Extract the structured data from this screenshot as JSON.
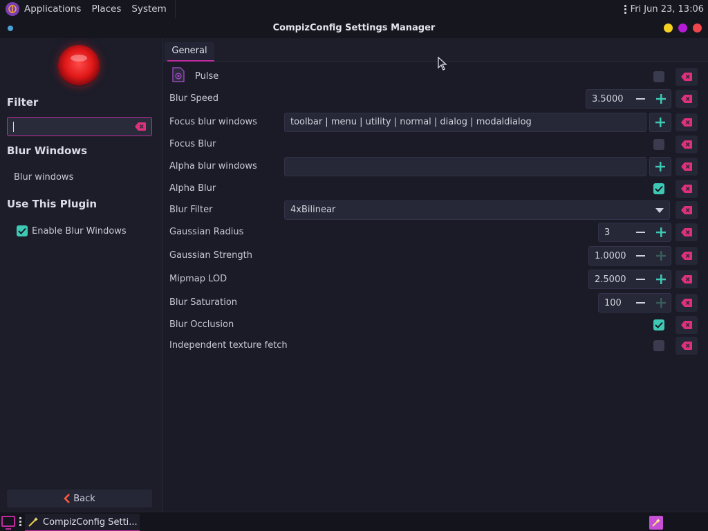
{
  "top_panel": {
    "menu": [
      "Applications",
      "Places",
      "System"
    ],
    "clock": "Fri Jun 23, 13:06"
  },
  "window": {
    "title": "CompizConfig Settings Manager",
    "controls": [
      "minimize",
      "maximize",
      "close"
    ],
    "control_colors": [
      "#f4d21f",
      "#b61bd8",
      "#f0464b"
    ]
  },
  "sidebar": {
    "filter_heading": "Filter",
    "filter_value": "",
    "plugin_heading": "Blur Windows",
    "plugin_description": "Blur windows",
    "use_heading": "Use This Plugin",
    "enable_label": "Enable Blur Windows",
    "enable_checked": true,
    "back_label": "Back"
  },
  "tabs": [
    {
      "label": "General",
      "active": true
    }
  ],
  "settings": [
    {
      "label": "Pulse",
      "type": "checkbox",
      "checked": false
    },
    {
      "label": "Blur Speed",
      "type": "spin",
      "value": "3.5000",
      "plus_enabled": true
    },
    {
      "label": "Focus blur windows",
      "type": "match",
      "value": "toolbar | menu | utility | normal | dialog | modaldialog"
    },
    {
      "label": "Focus Blur",
      "type": "checkbox",
      "checked": false
    },
    {
      "label": "Alpha blur windows",
      "type": "match",
      "value": ""
    },
    {
      "label": "Alpha Blur",
      "type": "checkbox",
      "checked": true
    },
    {
      "label": "Blur Filter",
      "type": "combo",
      "value": "4xBilinear"
    },
    {
      "label": "Gaussian Radius",
      "type": "spin",
      "value": "3",
      "plus_enabled": true
    },
    {
      "label": "Gaussian Strength",
      "type": "spin",
      "value": "1.0000",
      "plus_enabled": false
    },
    {
      "label": "Mipmap LOD",
      "type": "spin",
      "value": "2.5000",
      "plus_enabled": true
    },
    {
      "label": "Blur Saturation",
      "type": "spin",
      "value": "100",
      "plus_enabled": false
    },
    {
      "label": "Blur Occlusion",
      "type": "checkbox",
      "checked": true
    },
    {
      "label": "Independent texture fetch",
      "type": "checkbox",
      "checked": false
    }
  ],
  "taskbar": {
    "task_label": "CompizConfig Setti..."
  },
  "colors": {
    "accent": "#c02a9e",
    "check": "#3ec9b5",
    "plus": "#3ec9b5",
    "clear": "#e0307a",
    "background": "#1a1b26"
  }
}
